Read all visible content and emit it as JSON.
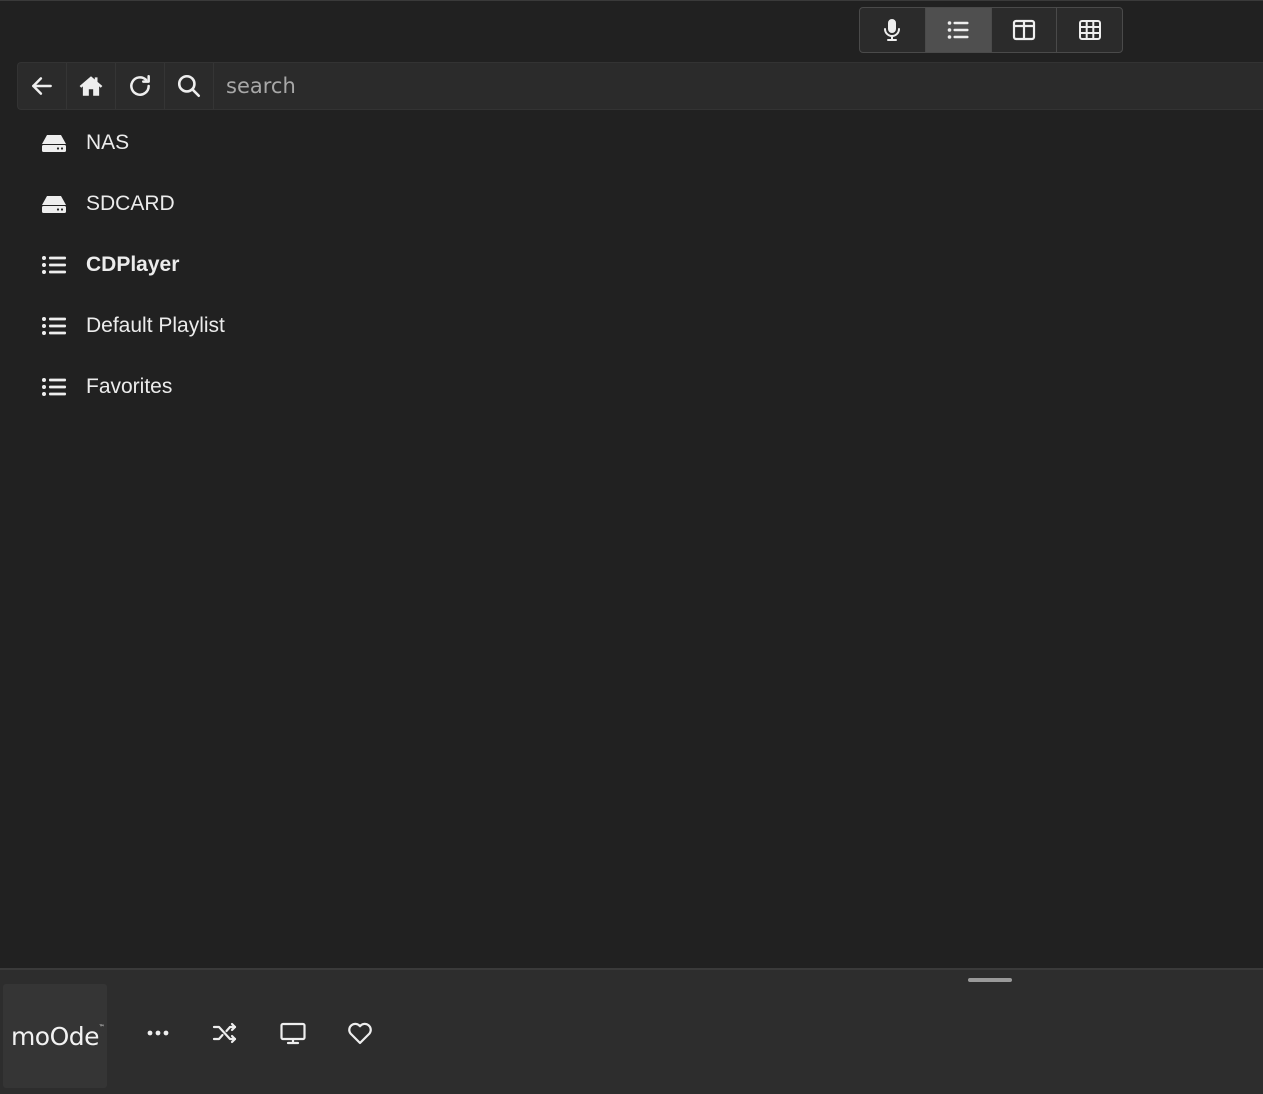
{
  "view_toggle": {
    "items": [
      {
        "icon": "microphone-icon",
        "active": false
      },
      {
        "icon": "list-icon",
        "active": true
      },
      {
        "icon": "columns-icon",
        "active": false
      },
      {
        "icon": "grid-icon",
        "active": false
      }
    ]
  },
  "toolbar": {
    "back_icon": "arrow-left-icon",
    "home_icon": "home-icon",
    "refresh_icon": "refresh-icon",
    "search_icon": "search-icon",
    "search_placeholder": "search",
    "search_value": ""
  },
  "browse": {
    "items": [
      {
        "label": "NAS",
        "icon": "drive-icon"
      },
      {
        "label": "SDCARD",
        "icon": "drive-icon"
      },
      {
        "label": "CDPlayer",
        "icon": "playlist-icon",
        "bold": true
      },
      {
        "label": "Default Playlist",
        "icon": "playlist-icon"
      },
      {
        "label": "Favorites",
        "icon": "playlist-icon"
      }
    ]
  },
  "footer": {
    "logo": "moOde",
    "logo_tm": "™",
    "buttons": [
      "more-icon",
      "shuffle-icon",
      "display-icon",
      "heart-icon"
    ]
  },
  "colors": {
    "background": "#212121",
    "toolbar": "#2b2b2b",
    "footer": "#2d2d2d",
    "active_toggle": "#4f4f4f",
    "text": "#ececec"
  }
}
